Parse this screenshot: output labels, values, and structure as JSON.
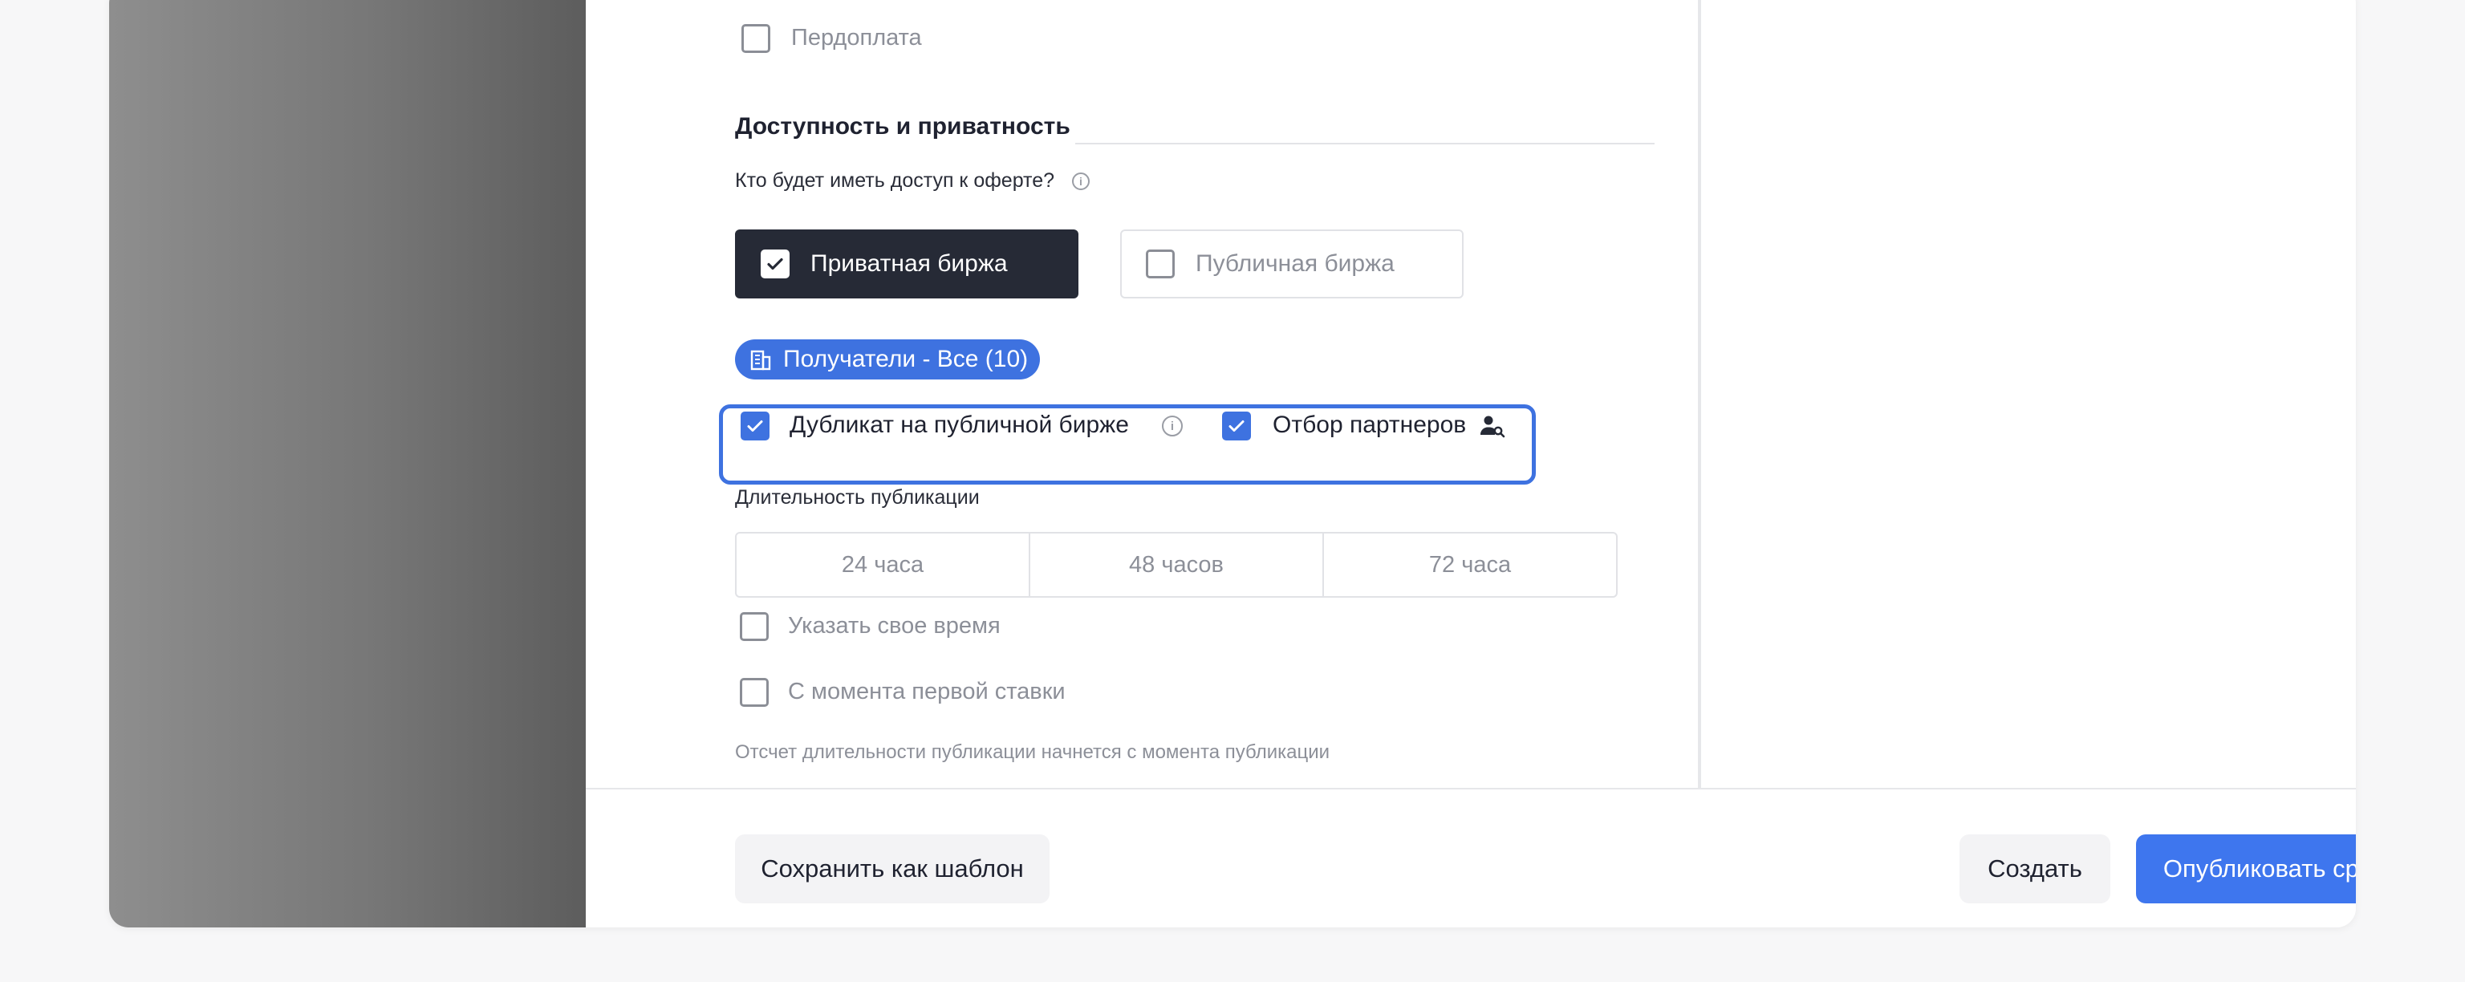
{
  "form": {
    "prepayment_label": "Пердоплата",
    "section_title": "Доступность и приватность",
    "access_question": "Кто будет иметь доступ к оферте?",
    "exchange_private": "Приватная биржа",
    "exchange_public": "Публичная биржа",
    "recipients_chip": "Получатели - Все (10)",
    "duplicate_label": "Дубликат на публичной бирже",
    "partner_selection_label": "Отбор партнеров",
    "duration_label": "Длительность публикации",
    "duration_options": [
      "24 часа",
      "48 часов",
      "72 часа"
    ],
    "custom_time_label": "Указать свое время",
    "first_bid_label": "С момента первой ставки",
    "hint_text": "Отсчет длительности публикации начнется с момента публикации"
  },
  "footer": {
    "save_template": "Сохранить как шаблон",
    "create": "Создать",
    "publish_now": "Опубликовать сразу"
  },
  "colors": {
    "accent": "#3e72e0",
    "dark_option": "#262a36"
  }
}
